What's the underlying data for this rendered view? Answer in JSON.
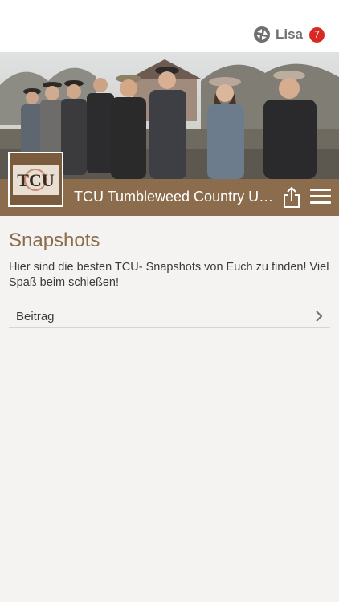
{
  "header": {
    "user_name": "Lisa",
    "notification_count": "7",
    "badge_color": "#d72a22"
  },
  "group": {
    "title": "TCU Tumbleweed Country Unicorns",
    "logo_text": "TCU",
    "bar_color": "#8b6d4d"
  },
  "page": {
    "title": "Snapshots",
    "description": "Hier sind die besten TCU- Snapshots von Euch zu finden! Viel Spaß beim schießen!"
  },
  "list": {
    "items": [
      {
        "label": "Beitrag"
      }
    ]
  },
  "icons": {
    "user_logo": "app-logo-icon",
    "share": "share-icon",
    "menu": "hamburger-menu-icon",
    "chevron": "chevron-right-icon"
  }
}
